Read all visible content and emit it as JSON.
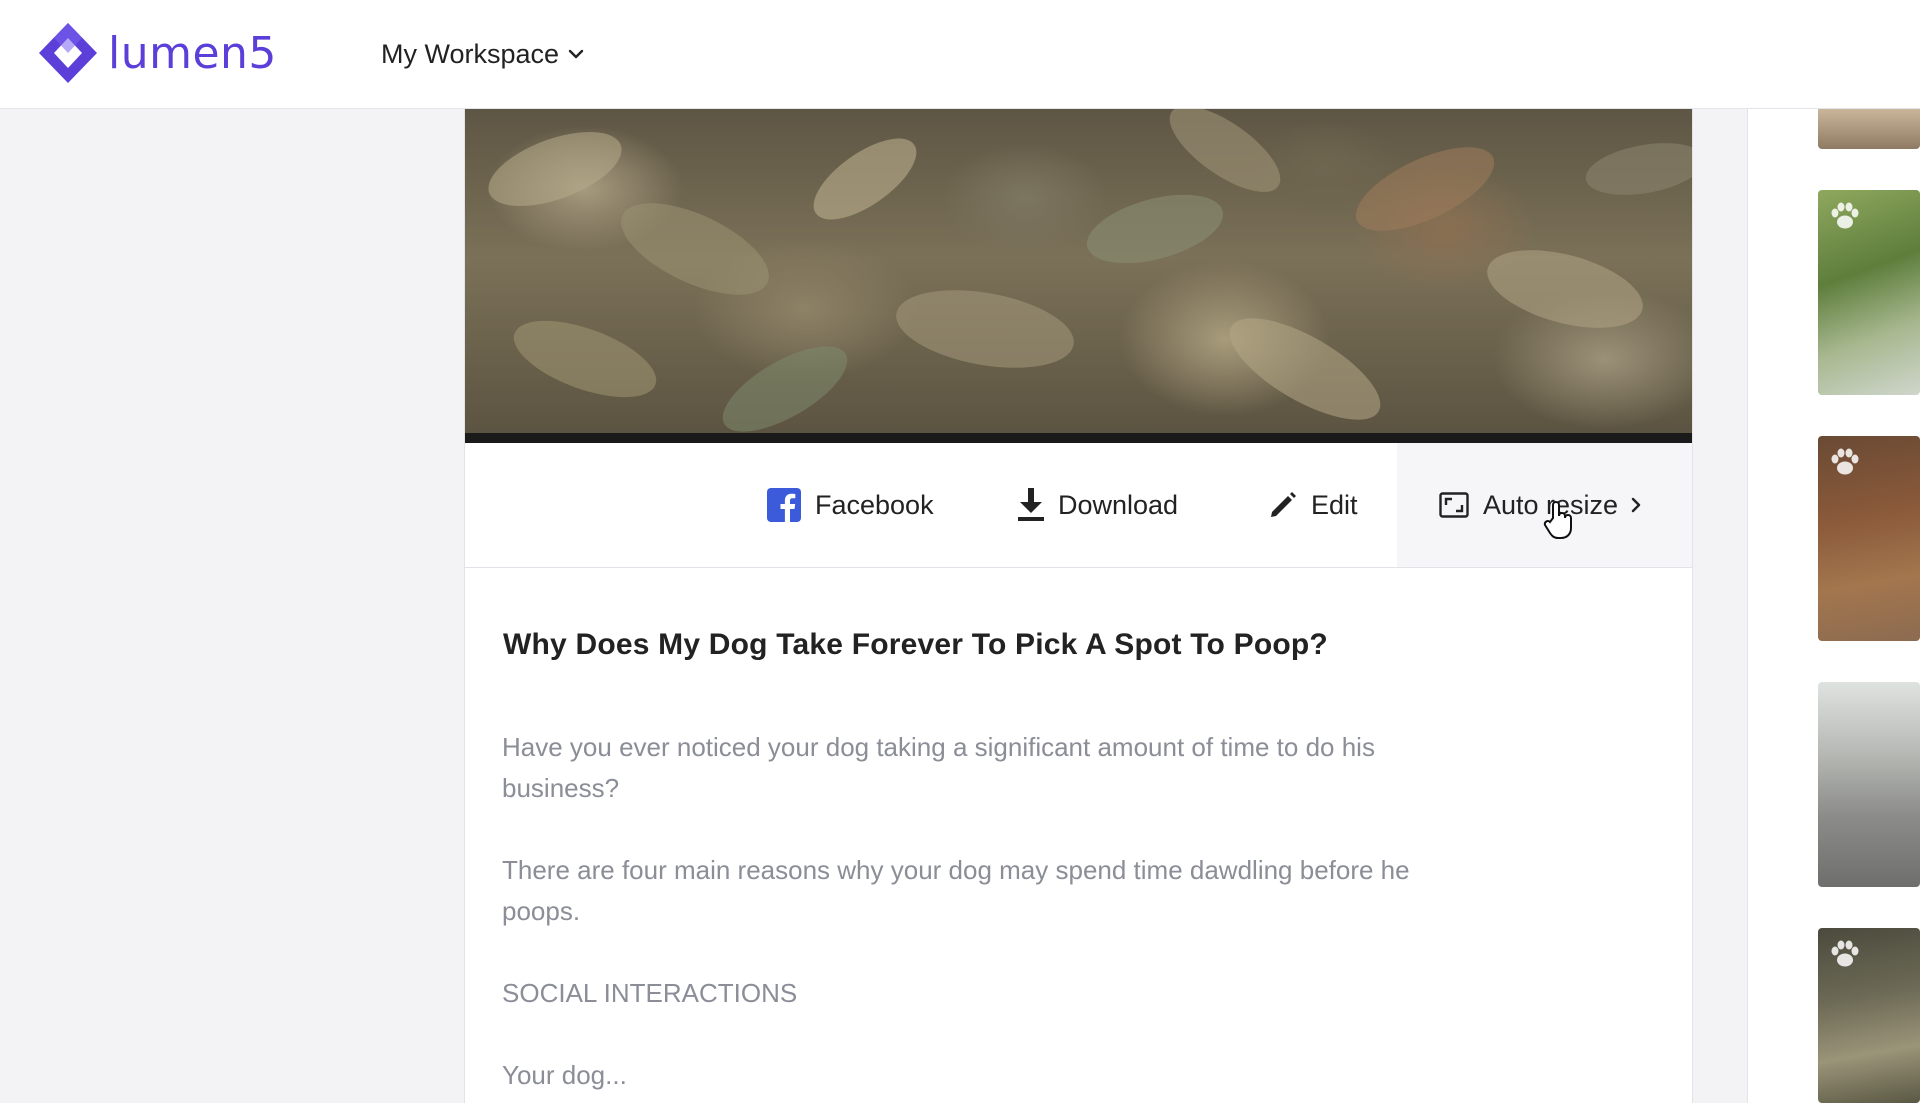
{
  "app": {
    "logo_text": "lumen5",
    "brand_color": "#5b3fd8",
    "workspace_label": "My Workspace"
  },
  "actions": {
    "facebook_label": "Facebook",
    "download_label": "Download",
    "edit_label": "Edit",
    "auto_resize_label": "Auto resize"
  },
  "article": {
    "title": "Why Does My Dog Take Forever To Pick A Spot To Poop?",
    "paragraphs": [
      "Have you ever noticed your dog taking a significant amount of time to do his business?",
      "There are four main reasons why your dog may spend time dawdling before he poops.",
      "SOCIAL INTERACTIONS",
      "Your dog..."
    ]
  },
  "thumbnails": [
    {
      "label": "dry-leaves-thumbnail"
    },
    {
      "label": "forest-path-thumbnail",
      "icon": "paw-icon"
    },
    {
      "label": "autumn-woods-thumbnail",
      "icon": "paw-icon"
    },
    {
      "label": "sofa-thumbnail"
    },
    {
      "label": "park-tree-thumbnail",
      "icon": "paw-icon"
    }
  ]
}
